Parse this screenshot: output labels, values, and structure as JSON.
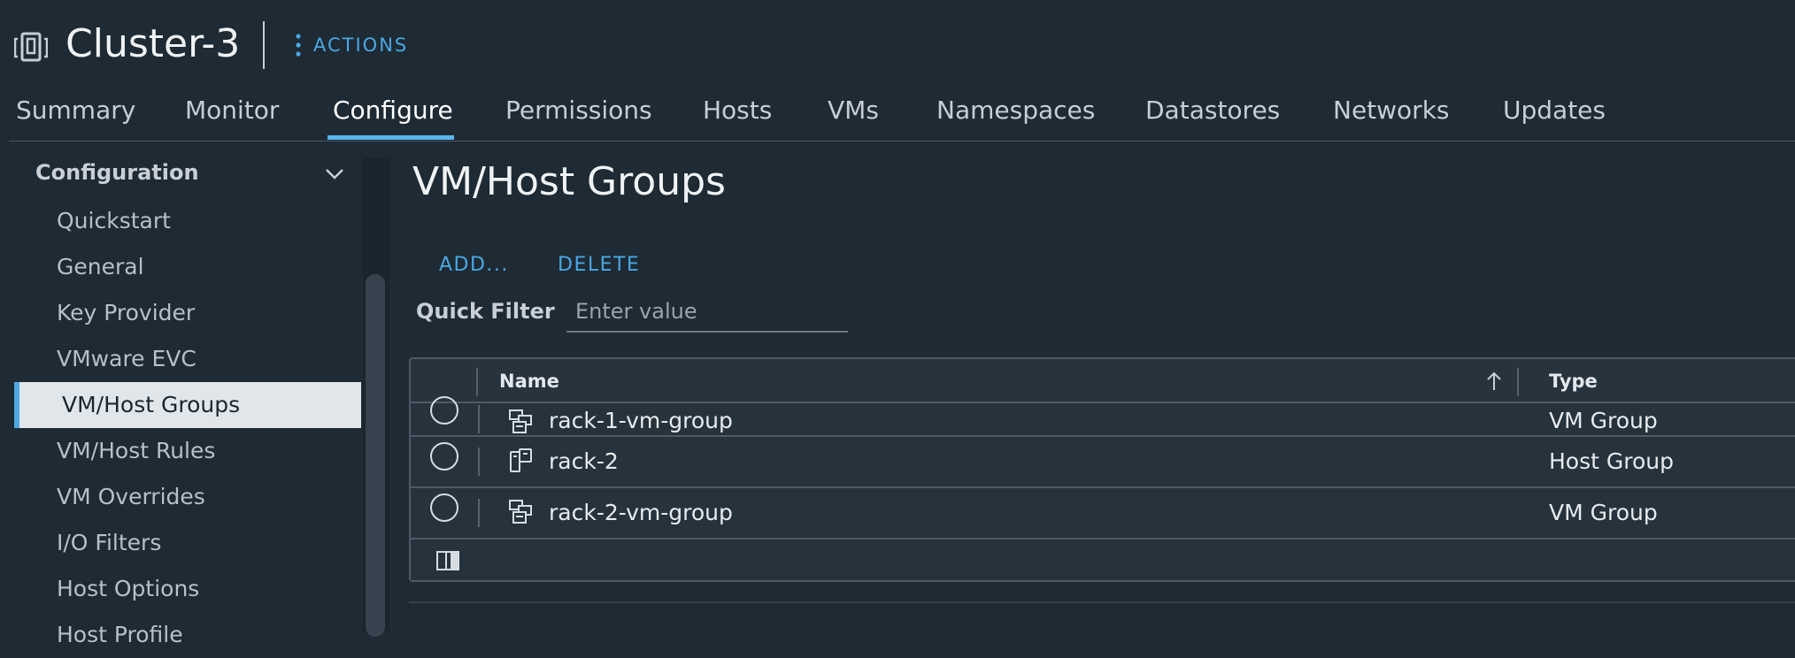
{
  "header": {
    "title": "Cluster-3",
    "actions_label": "ACTIONS",
    "object_icon": "cluster-icon"
  },
  "tabs": [
    {
      "label": "Summary",
      "active": false
    },
    {
      "label": "Monitor",
      "active": false
    },
    {
      "label": "Configure",
      "active": true
    },
    {
      "label": "Permissions",
      "active": false
    },
    {
      "label": "Hosts",
      "active": false
    },
    {
      "label": "VMs",
      "active": false
    },
    {
      "label": "Namespaces",
      "active": false
    },
    {
      "label": "Datastores",
      "active": false
    },
    {
      "label": "Networks",
      "active": false
    },
    {
      "label": "Updates",
      "active": false
    }
  ],
  "sidebar": {
    "section_label": "Configuration",
    "items": [
      {
        "label": "Quickstart"
      },
      {
        "label": "General"
      },
      {
        "label": "Key Provider"
      },
      {
        "label": "VMware EVC"
      },
      {
        "label": "VM/Host Groups",
        "active": true
      },
      {
        "label": "VM/Host Rules"
      },
      {
        "label": "VM Overrides"
      },
      {
        "label": "I/O Filters"
      },
      {
        "label": "Host Options"
      },
      {
        "label": "Host Profile"
      }
    ]
  },
  "main": {
    "title": "VM/Host Groups",
    "add_label": "ADD...",
    "delete_label": "DELETE",
    "quick_filter_label": "Quick Filter",
    "quick_filter_placeholder": "Enter value",
    "quick_filter_value": ""
  },
  "grid": {
    "columns": [
      {
        "label": "Name",
        "sorted": "ascending"
      },
      {
        "label": "Type"
      }
    ],
    "rows": [
      {
        "name": "rack-1-vm-group",
        "type": "VM Group",
        "icon": "vm-group-icon"
      },
      {
        "name": "rack-2",
        "type": "Host Group",
        "icon": "host-group-icon"
      },
      {
        "name": "rack-2-vm-group",
        "type": "VM Group",
        "icon": "vm-group-icon"
      }
    ]
  },
  "colors": {
    "background": "#1e2a34",
    "accent": "#4aa8e3",
    "active_tab_underline": "#5ab4ec",
    "selected_nav_bg": "#e0e6ea"
  }
}
